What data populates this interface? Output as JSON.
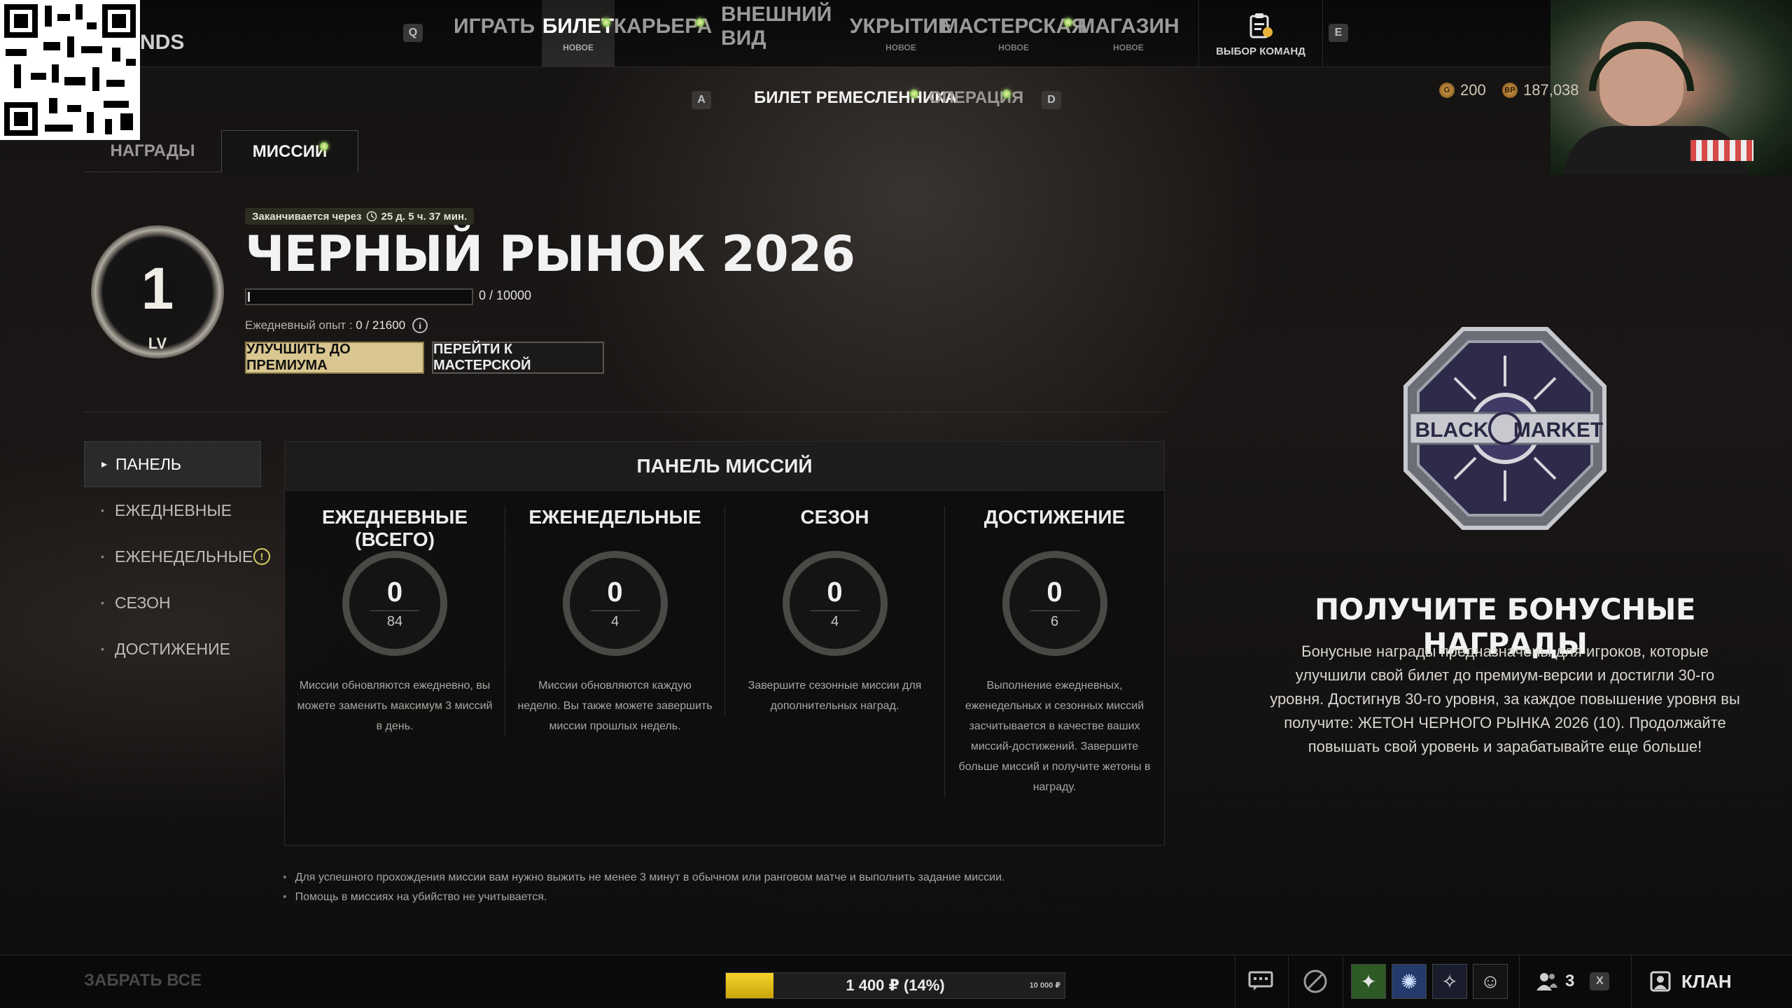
{
  "brand_fragment": "NDS",
  "nav": {
    "key_left": "Q",
    "key_right": "E",
    "items": [
      {
        "label": "ИГРАТЬ",
        "sub": ""
      },
      {
        "label": "БИЛЕТ",
        "sub": "НОВОЕ"
      },
      {
        "label": "КАРЬЕРА",
        "sub": ""
      },
      {
        "label": "ВНЕШНИЙ ВИД",
        "sub": ""
      },
      {
        "label": "УКРЫТИЕ",
        "sub": "НОВОЕ"
      },
      {
        "label": "МАСТЕРСКАЯ",
        "sub": "НОВОЕ"
      },
      {
        "label": "МАГАЗИН",
        "sub": "НОВОЕ"
      }
    ],
    "team_select": "ВЫБОР КОМАНД"
  },
  "currency": {
    "g_symbol": "G",
    "g_value": "200",
    "bp_symbol": "BP",
    "bp_value": "187,038"
  },
  "subtabs": {
    "key_left": "A",
    "key_right": "D",
    "craftsman": "БИЛЕТ РЕМЕСЛЕННИКА",
    "operation": "ОПЕРАЦИЯ"
  },
  "tabs": {
    "rewards": "НАГРАДЫ",
    "missions": "МИССИИ"
  },
  "level": {
    "number": "1",
    "label": "LV"
  },
  "season": {
    "expires_label": "Заканчивается через",
    "expires_value": "25 д. 5 ч. 37 мин.",
    "title": "ЧЕРНЫЙ РЫНОК 2026",
    "xp_text": "0 / 10000",
    "xp_progress": 0,
    "daily_label": "Ежедневный опыт : ",
    "daily_value": "0 / 21600",
    "info": "i",
    "upgrade_button": "УЛУЧШИТЬ ДО ПРЕМИУМА",
    "workshop_button": "ПЕРЕЙТИ К МАСТЕРСКОЙ"
  },
  "sidebar": {
    "items": [
      {
        "label": "ПАНЕЛЬ"
      },
      {
        "label": "ЕЖЕДНЕВНЫЕ"
      },
      {
        "label": "ЕЖЕНЕДЕЛЬНЫЕ"
      },
      {
        "label": "СЕЗОН"
      },
      {
        "label": "ДОСТИЖЕНИЕ"
      }
    ],
    "warn_symbol": "!"
  },
  "panel": {
    "title": "ПАНЕЛЬ МИССИЙ",
    "columns": [
      {
        "title": "ЕЖЕДНЕВНЫЕ (ВСЕГО)",
        "done": "0",
        "total": "84",
        "desc": "Миссии обновляются ежедневно, вы можете заменить максимум 3 миссий в день."
      },
      {
        "title": "ЕЖЕНЕДЕЛЬНЫЕ",
        "done": "0",
        "total": "4",
        "desc": "Миссии обновляются каждую неделю. Вы также можете завершить миссии прошлых недель."
      },
      {
        "title": "СЕЗОН",
        "done": "0",
        "total": "4",
        "desc": "Завершите сезонные миссии для дополнительных наград."
      },
      {
        "title": "ДОСТИЖЕНИЕ",
        "done": "0",
        "total": "6",
        "desc": "Выполнение ежедневных, еженедельных и сезонных миссий засчитывается в качестве ваших миссий-достижений. Завершите больше миссий и получите жетоны в награду."
      }
    ]
  },
  "bonus": {
    "badge_left": "BLACK",
    "badge_right": "MARKET",
    "title": "ПОЛУЧИТЕ БОНУСНЫЕ НАГРАДЫ",
    "text": "Бонусные награды предназначены для игроков, которые улучшили свой билет до премиум-версии и достигли 30-го уровня. Достигнув 30-го уровня, за каждое повышение уровня вы получите: ЖЕТОН ЧЕРНОГО РЫНКА 2026 (10). Продолжайте повышать свой уровень и зарабатывайте еще больше!"
  },
  "notes": [
    "Для успешного прохождения миссии вам нужно выжить не менее 3 минут в обычном или ранговом матче и выполнить задание миссии.",
    "Помощь в миссиях на убийство не учитывается."
  ],
  "bottom": {
    "claim_all": "ЗАБРАТЬ ВСЕ",
    "progress_text": "1 400 ₽ (14%)",
    "progress_percent": 14,
    "progress_cap": "10 000 ₽",
    "party_count": "3",
    "party_key": "X",
    "clan": "КЛАН"
  },
  "colors": {
    "accent_gold": "#d9c690",
    "progress_yellow": "#f5d32a",
    "new_dot": "#9fd46a",
    "warning": "#d8cf63"
  }
}
